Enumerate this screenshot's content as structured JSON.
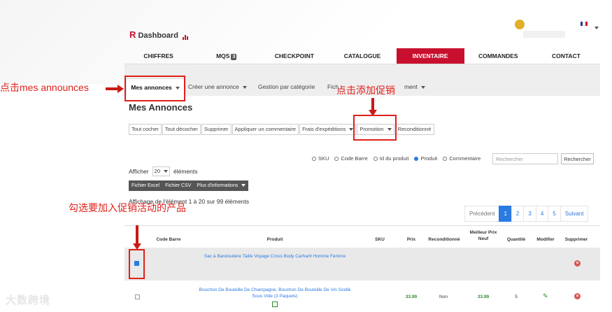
{
  "header": {
    "logo_text": "Dashboard",
    "logo_letter": "R"
  },
  "nav": {
    "items": [
      "CHIFFRES",
      "MQS",
      "CHECKPOINT",
      "CATALOGUE",
      "INVENTAIRE",
      "COMMANDES",
      "CONTACT"
    ],
    "mqs_badge": "3",
    "active": "INVENTAIRE"
  },
  "subnav": {
    "items": [
      "Mes annonces",
      "Créer une annonce",
      "Gestion par catégorie",
      "Fich",
      "ment"
    ]
  },
  "page": {
    "title": "Mes Annonces"
  },
  "toolbar": {
    "buttons": [
      "Tout cocher",
      "Tout décocher",
      "Supprimer",
      "Appliquer un commentaire",
      "Frais d'expéditions",
      "Promotion",
      "Reconditionné"
    ]
  },
  "search": {
    "options": [
      "SKU",
      "Code Barre",
      "Id du produit",
      "Produit",
      "Commentaire"
    ],
    "selected": "Produit",
    "placeholder": "Rechercher",
    "button": "Rechercher"
  },
  "list": {
    "show_label": "Afficher",
    "page_size": "20",
    "elements_label": "éléments",
    "export": [
      "Fichier Excel",
      "Fichier CSV",
      "Plus d'informations"
    ],
    "info": "Affichage de l'élément 1 à 20 sur 99 éléments"
  },
  "pagination": {
    "prev": "Précédent",
    "pages": [
      "1",
      "2",
      "3",
      "4",
      "5"
    ],
    "active": "1",
    "next": "Suivant"
  },
  "table": {
    "headers": [
      "Code Barre",
      "Produit",
      "SKU",
      "Prix",
      "Reconditionné",
      "Meilleur Prix Neuf",
      "Quantité",
      "Modifier",
      "Supprimer"
    ],
    "rows": [
      {
        "checked": true,
        "product": "Sac à Bandoulière Taille Voyage Cross Body Carhartt Homme Femme"
      },
      {
        "checked": false,
        "product": "Bouchon De Bouteille De Champagne, Bouchon De Bouteille De Vin Scellé Sous Vide (3 Paquets)",
        "price": "33.99",
        "reconditioned": "Non",
        "best_new_price": "33.99",
        "quantity": "5"
      }
    ]
  },
  "annotations": {
    "step1": "点击mes announces",
    "step2": "点击添加促销",
    "step3": "勾选要加入促销活动的产品"
  },
  "watermark": "大数跨境",
  "colors": {
    "accent": "#c8102e",
    "link": "#2a7ae2",
    "annotation": "#e0201a"
  }
}
